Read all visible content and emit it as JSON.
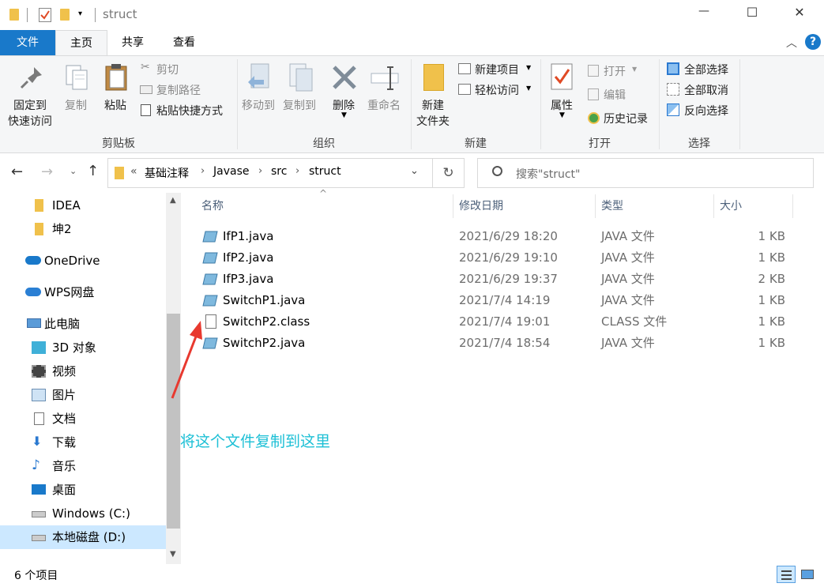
{
  "window": {
    "title": "struct",
    "controls": {
      "minimize": "—",
      "maximize": "☐",
      "close": "✕"
    }
  },
  "ribbon_tabs": [
    {
      "label": "文件"
    },
    {
      "label": "主页"
    },
    {
      "label": "共享"
    },
    {
      "label": "查看"
    }
  ],
  "ribbon": {
    "clipboard": {
      "label": "剪贴板",
      "pin_l1": "固定到",
      "pin_l2": "快速访问",
      "copy": "复制",
      "paste": "粘贴",
      "cut": "剪切",
      "copy_path": "复制路径",
      "paste_shortcut": "粘贴快捷方式"
    },
    "organize": {
      "label": "组织",
      "move_to": "移动到",
      "copy_to": "复制到",
      "delete": "删除",
      "rename": "重命名"
    },
    "new": {
      "label": "新建",
      "new_folder_l1": "新建",
      "new_folder_l2": "文件夹",
      "new_item": "新建项目",
      "easy_access": "轻松访问"
    },
    "open": {
      "label": "打开",
      "properties": "属性",
      "open": "打开",
      "edit": "编辑",
      "history": "历史记录"
    },
    "select": {
      "label": "选择",
      "select_all": "全部选择",
      "select_none": "全部取消",
      "invert": "反向选择"
    }
  },
  "address": {
    "prefix": "«",
    "crumbs": [
      "基础注释",
      "Javase",
      "src",
      "struct"
    ],
    "search_placeholder": "搜索\"struct\""
  },
  "nav": [
    {
      "label": "IDEA",
      "icon": "folder-icon"
    },
    {
      "label": "坤2",
      "icon": "folder-icon"
    },
    {
      "label": "OneDrive",
      "icon": "cloud-icon"
    },
    {
      "label": "WPS网盘",
      "icon": "cloud-icon"
    },
    {
      "label": "此电脑",
      "icon": "computer-icon"
    },
    {
      "label": "3D 对象",
      "icon": "cube-icon"
    },
    {
      "label": "视频",
      "icon": "video-icon"
    },
    {
      "label": "图片",
      "icon": "picture-icon"
    },
    {
      "label": "文档",
      "icon": "document-icon"
    },
    {
      "label": "下载",
      "icon": "download-icon"
    },
    {
      "label": "音乐",
      "icon": "music-icon"
    },
    {
      "label": "桌面",
      "icon": "desktop-icon"
    },
    {
      "label": "Windows (C:)",
      "icon": "drive-icon"
    },
    {
      "label": "本地磁盘 (D:)",
      "icon": "drive-icon"
    }
  ],
  "columns": {
    "name": "名称",
    "date": "修改日期",
    "type": "类型",
    "size": "大小"
  },
  "files": [
    {
      "name": "IfP1.java",
      "date": "2021/6/29 18:20",
      "type": "JAVA 文件",
      "size": "1 KB",
      "icon": "java-file-icon"
    },
    {
      "name": "IfP2.java",
      "date": "2021/6/29 19:10",
      "type": "JAVA 文件",
      "size": "1 KB",
      "icon": "java-file-icon"
    },
    {
      "name": "IfP3.java",
      "date": "2021/6/29 19:37",
      "type": "JAVA 文件",
      "size": "2 KB",
      "icon": "java-file-icon"
    },
    {
      "name": "SwitchP1.java",
      "date": "2021/7/4 14:19",
      "type": "JAVA 文件",
      "size": "1 KB",
      "icon": "java-file-icon"
    },
    {
      "name": "SwitchP2.class",
      "date": "2021/7/4 19:01",
      "type": "CLASS 文件",
      "size": "1 KB",
      "icon": "blank-file-icon"
    },
    {
      "name": "SwitchP2.java",
      "date": "2021/7/4 18:54",
      "type": "JAVA 文件",
      "size": "1 KB",
      "icon": "java-file-icon"
    }
  ],
  "annotation": {
    "text": "将这个文件复制到这里",
    "color": "#1ec0d6",
    "arrow_color": "#e8392f"
  },
  "status": {
    "count": "6 个项目"
  },
  "colors": {
    "accent": "#1979ca",
    "folder": "#f0c14b"
  }
}
